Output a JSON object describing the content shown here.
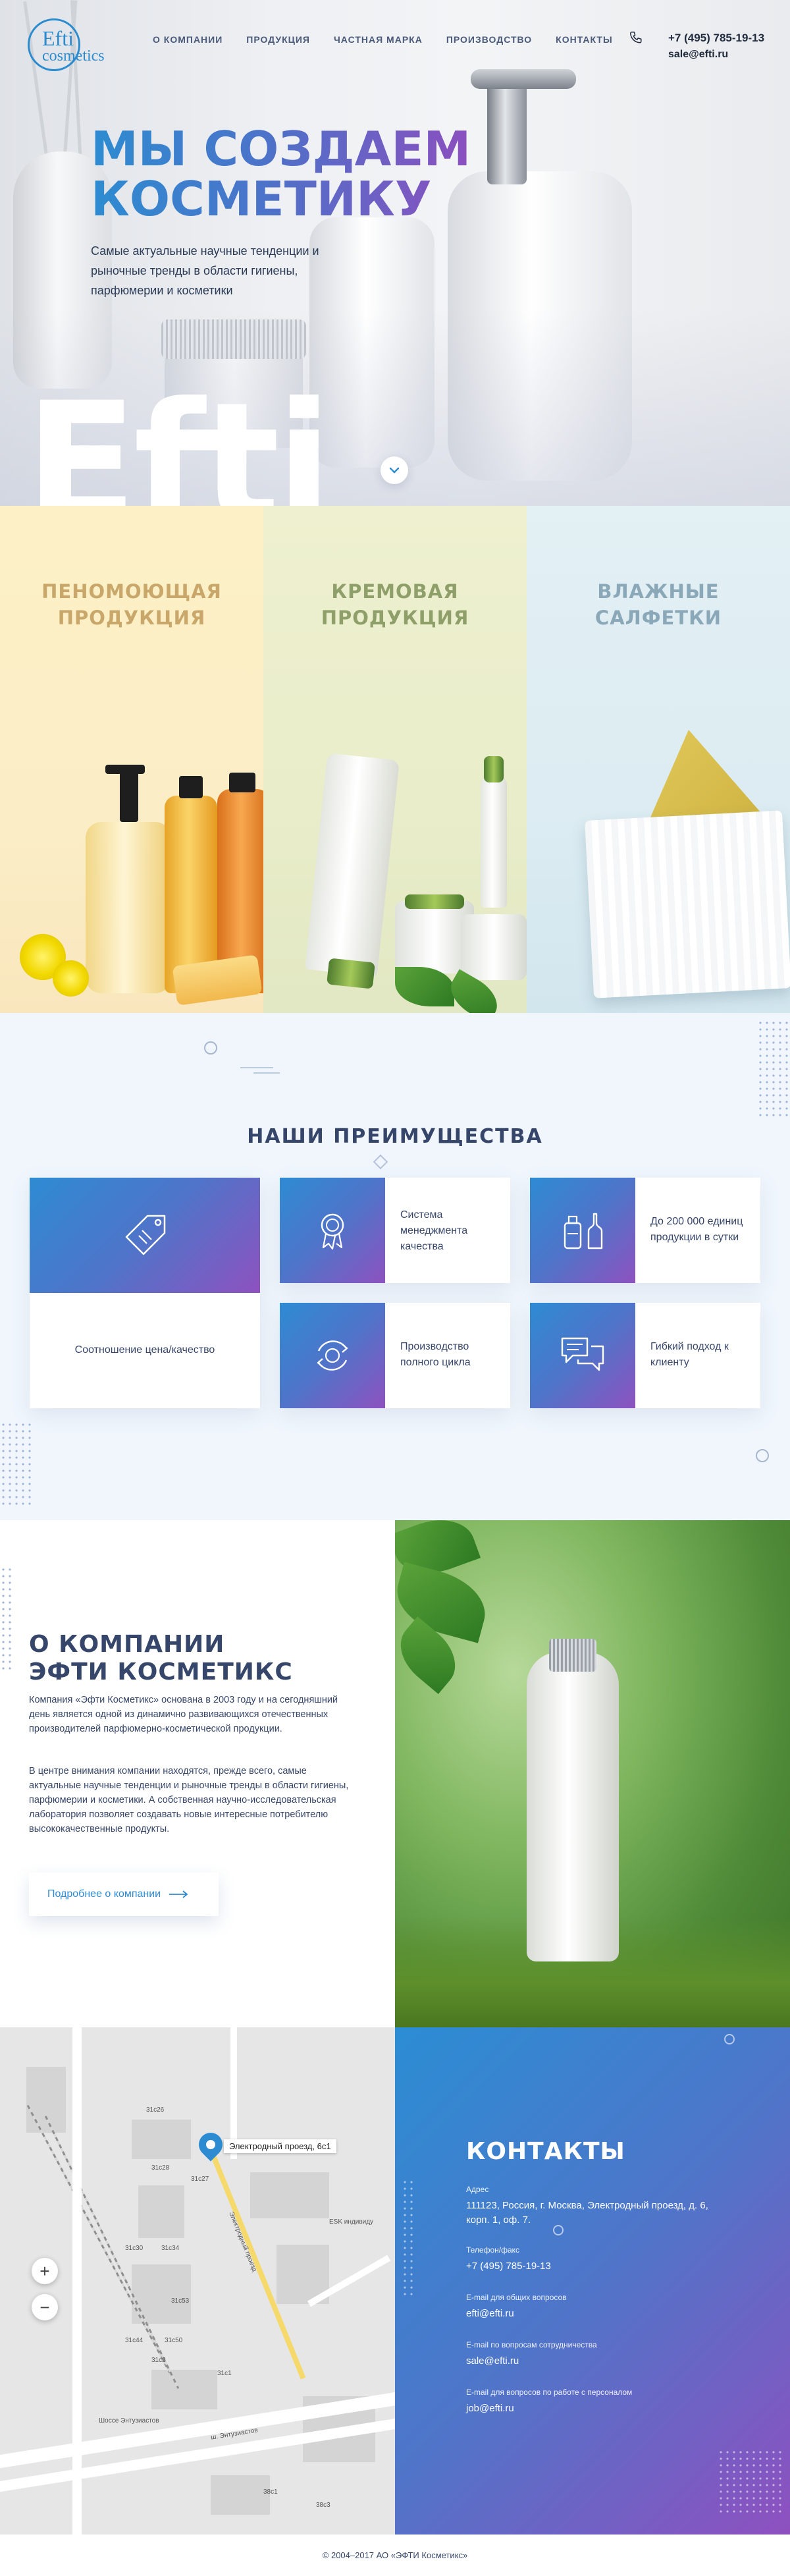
{
  "header": {
    "logo_line1": "Efti",
    "logo_line2": "cosmetics",
    "nav": [
      "О компании",
      "Продукция",
      "Частная марка",
      "Производство",
      "Контакты"
    ],
    "phone": "+7 (495) 785-19-13",
    "email": "sale@efti.ru"
  },
  "hero": {
    "title_line1": "Мы создаем",
    "title_line2": "косметику",
    "lead": "Самые актуальные научные тенденции и рыночные тренды в области гигиены, парфюмерии и косметики",
    "bigword": "Efti"
  },
  "categories": [
    {
      "line1": "Пеномоющая",
      "line2": "продукция"
    },
    {
      "line1": "Кремовая",
      "line2": "продукция"
    },
    {
      "line1": "Влажные",
      "line2": "салфетки"
    }
  ],
  "advantages": {
    "title": "Наши преимущества",
    "items": [
      {
        "icon": "price-tag-icon",
        "text": "Соотношение цена/качество"
      },
      {
        "icon": "medal-icon",
        "text": "Система менеджмента качества"
      },
      {
        "icon": "bottles-icon",
        "text": "До 200 000 единиц продукции в сутки"
      },
      {
        "icon": "cycle-icon",
        "text": "Производство полного цикла"
      },
      {
        "icon": "chat-bubbles-icon",
        "text": "Гибкий подход к клиенту"
      }
    ]
  },
  "about": {
    "title_line1": "О компании",
    "title_line2": "Эфти Косметикс",
    "p1": "Компания «Эфти Косметикс» основана в 2003 году и на сегодняшний день является одной из динамично развивающихся отечественных производителей парфюмерно-косметической продукции.",
    "p2": "В центре внимания компании находятся, прежде всего, самые актуальные научные тенденции и рыночные тренды в области гигиены, парфюмерии и косметики. А собственная научно-исследовательская лаборатория позволяет создавать новые интересные потребителю высококачественные продукты.",
    "button": "Подробнее о компании"
  },
  "map": {
    "pin_label": "Электродный проезд, 6с1",
    "labels": [
      "Шоссе Энтузиастов",
      "ш. Энтузиастов",
      "Электродный проезд",
      "31с26",
      "31с27",
      "31с28",
      "31с30",
      "31с34",
      "31с44",
      "31с50",
      "31с53",
      "38с1",
      "38с3",
      "31с1",
      "31с2",
      "ESK индивиду"
    ],
    "zoom_in": "+",
    "zoom_out": "−"
  },
  "contacts": {
    "title": "Контакты",
    "items": [
      {
        "label": "Адрес",
        "value": "111123, Россия, г. Москва, Электродный проезд, д. 6, корп. 1, оф. 7."
      },
      {
        "label": "Телефон/факс",
        "value": "+7 (495) 785-19-13"
      },
      {
        "label": "E-mail для общих вопросов",
        "value": "efti@efti.ru"
      },
      {
        "label": "E-mail по вопросам сотрудничества",
        "value": "sale@efti.ru"
      },
      {
        "label": "E-mail для вопросов по работе с персоналом",
        "value": "job@efti.ru"
      }
    ]
  },
  "footer": {
    "copyright": "© 2004–2017 АО «ЭФТИ Косметикс»"
  },
  "colors": {
    "accent_blue": "#2d8cd1",
    "accent_purple": "#8e52bf",
    "text_dark": "#36466a"
  }
}
